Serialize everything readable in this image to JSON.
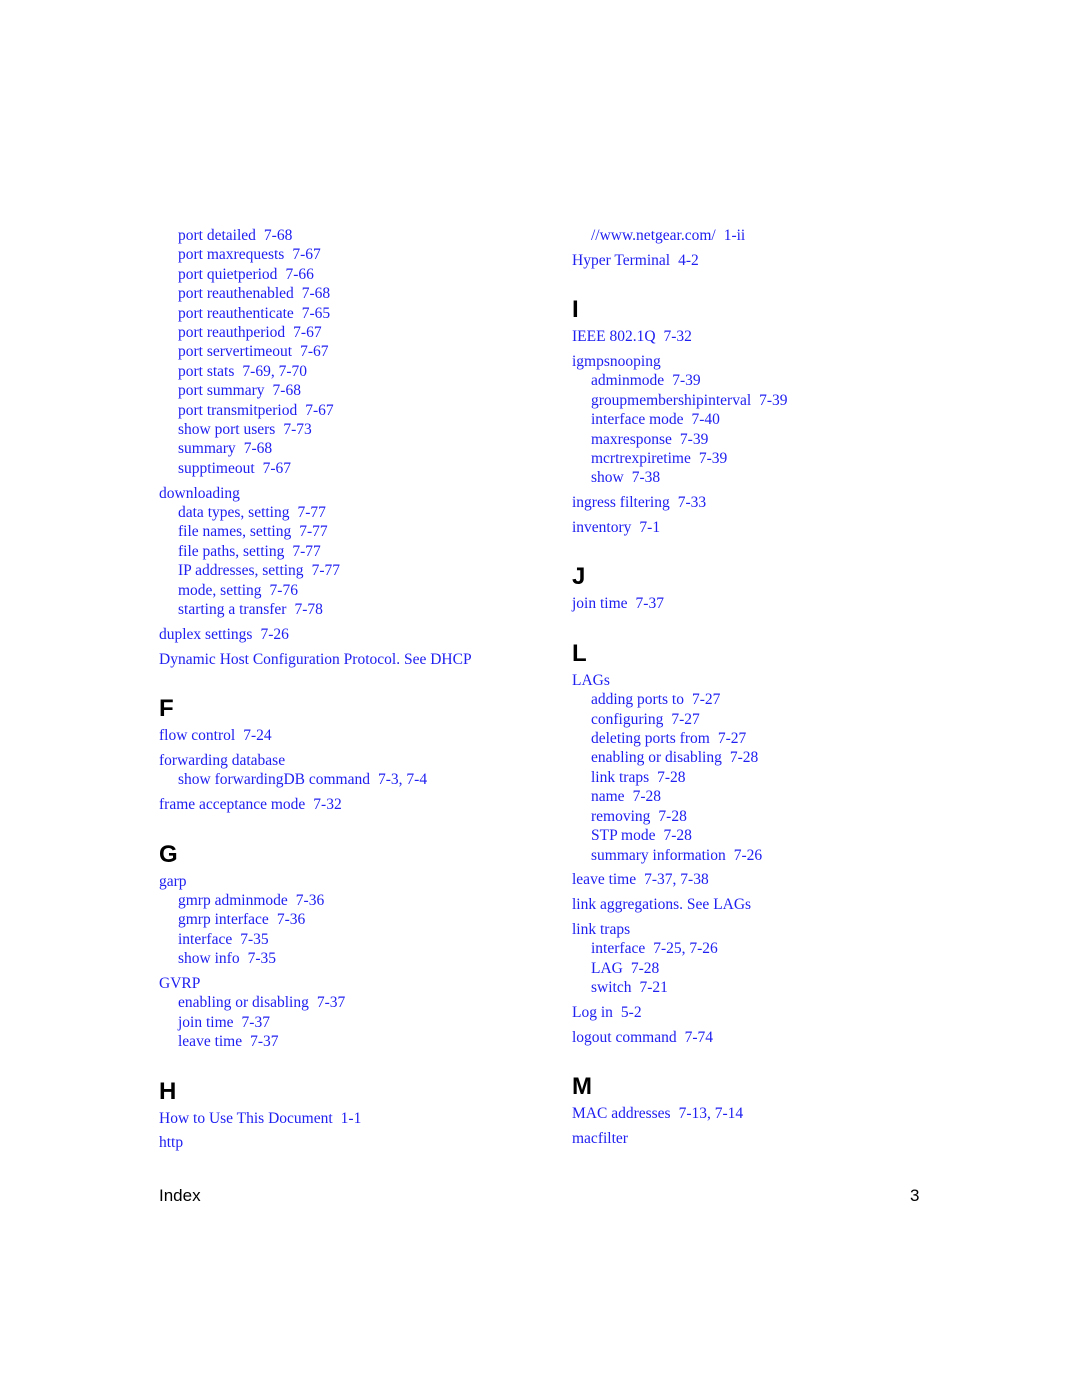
{
  "left_column": [
    {
      "type": "sub",
      "term": "port detailed",
      "pages": "7-68"
    },
    {
      "type": "sub",
      "term": "port maxrequests",
      "pages": "7-67"
    },
    {
      "type": "sub",
      "term": "port quietperiod",
      "pages": "7-66"
    },
    {
      "type": "sub",
      "term": "port reauthenabled",
      "pages": "7-68"
    },
    {
      "type": "sub",
      "term": "port reauthenticate",
      "pages": "7-65"
    },
    {
      "type": "sub",
      "term": "port reauthperiod",
      "pages": "7-67"
    },
    {
      "type": "sub",
      "term": "port servertimeout",
      "pages": "7-67"
    },
    {
      "type": "sub",
      "term": "port stats",
      "pages": "7-69, 7-70"
    },
    {
      "type": "sub",
      "term": "port summary",
      "pages": "7-68"
    },
    {
      "type": "sub",
      "term": "port transmitperiod",
      "pages": "7-67"
    },
    {
      "type": "sub",
      "term": "show port users",
      "pages": "7-73"
    },
    {
      "type": "sub",
      "term": "summary",
      "pages": "7-68"
    },
    {
      "type": "sub",
      "term": "supptimeout",
      "pages": "7-67"
    },
    {
      "type": "top",
      "term": "downloading",
      "pages": ""
    },
    {
      "type": "sub",
      "term": "data types, setting",
      "pages": "7-77"
    },
    {
      "type": "sub",
      "term": "file names, setting",
      "pages": "7-77"
    },
    {
      "type": "sub",
      "term": "file paths, setting",
      "pages": "7-77"
    },
    {
      "type": "sub",
      "term": "IP addresses, setting",
      "pages": "7-77"
    },
    {
      "type": "sub",
      "term": "mode, setting",
      "pages": "7-76"
    },
    {
      "type": "sub",
      "term": "starting a transfer",
      "pages": "7-78"
    },
    {
      "type": "top",
      "term": "duplex settings",
      "pages": "7-26"
    },
    {
      "type": "top",
      "term": "Dynamic Host Configuration Protocol. See DHCP",
      "pages": ""
    },
    {
      "type": "letter",
      "term": "F"
    },
    {
      "type": "top",
      "term": "flow control",
      "pages": "7-24"
    },
    {
      "type": "top",
      "term": "forwarding database",
      "pages": ""
    },
    {
      "type": "sub",
      "term": "show forwardingDB command",
      "pages": "7-3, 7-4"
    },
    {
      "type": "top",
      "term": "frame acceptance mode",
      "pages": "7-32"
    },
    {
      "type": "letter",
      "term": "G"
    },
    {
      "type": "top",
      "term": "garp",
      "pages": ""
    },
    {
      "type": "sub",
      "term": "gmrp adminmode",
      "pages": "7-36"
    },
    {
      "type": "sub",
      "term": "gmrp interface",
      "pages": "7-36"
    },
    {
      "type": "sub",
      "term": "interface",
      "pages": "7-35"
    },
    {
      "type": "sub",
      "term": "show info",
      "pages": "7-35"
    },
    {
      "type": "top",
      "term": "GVRP",
      "pages": ""
    },
    {
      "type": "sub",
      "term": "enabling or disabling",
      "pages": "7-37"
    },
    {
      "type": "sub",
      "term": "join time",
      "pages": "7-37"
    },
    {
      "type": "sub",
      "term": "leave time",
      "pages": "7-37"
    },
    {
      "type": "letter",
      "term": "H"
    },
    {
      "type": "top",
      "term": "How to Use This Document",
      "pages": "1-1"
    },
    {
      "type": "top",
      "term": "http",
      "pages": ""
    }
  ],
  "right_column": [
    {
      "type": "sub",
      "term": "//www.netgear.com/",
      "pages": "1-ii"
    },
    {
      "type": "top",
      "term": "Hyper Terminal",
      "pages": "4-2"
    },
    {
      "type": "letter",
      "term": "I"
    },
    {
      "type": "top",
      "term": "IEEE 802.1Q",
      "pages": "7-32"
    },
    {
      "type": "top",
      "term": "igmpsnooping",
      "pages": ""
    },
    {
      "type": "sub",
      "term": "adminmode",
      "pages": "7-39"
    },
    {
      "type": "sub",
      "term": "groupmembershipinterval",
      "pages": "7-39"
    },
    {
      "type": "sub",
      "term": "interface mode",
      "pages": "7-40"
    },
    {
      "type": "sub",
      "term": "maxresponse",
      "pages": "7-39"
    },
    {
      "type": "sub",
      "term": "mcrtrexpiretime",
      "pages": "7-39"
    },
    {
      "type": "sub",
      "term": "show",
      "pages": "7-38"
    },
    {
      "type": "top",
      "term": "ingress filtering",
      "pages": "7-33"
    },
    {
      "type": "top",
      "term": "inventory",
      "pages": "7-1"
    },
    {
      "type": "letter",
      "term": "J"
    },
    {
      "type": "top",
      "term": "join time",
      "pages": "7-37"
    },
    {
      "type": "letter",
      "term": "L"
    },
    {
      "type": "top",
      "term": "LAGs",
      "pages": ""
    },
    {
      "type": "sub",
      "term": "adding ports to",
      "pages": "7-27"
    },
    {
      "type": "sub",
      "term": "configuring",
      "pages": "7-27"
    },
    {
      "type": "sub",
      "term": "deleting ports from",
      "pages": "7-27"
    },
    {
      "type": "sub",
      "term": "enabling or disabling",
      "pages": "7-28"
    },
    {
      "type": "sub",
      "term": "link traps",
      "pages": "7-28"
    },
    {
      "type": "sub",
      "term": "name",
      "pages": "7-28"
    },
    {
      "type": "sub",
      "term": "removing",
      "pages": "7-28"
    },
    {
      "type": "sub",
      "term": "STP mode",
      "pages": "7-28"
    },
    {
      "type": "sub",
      "term": "summary information",
      "pages": "7-26"
    },
    {
      "type": "top",
      "term": "leave time",
      "pages": "7-37, 7-38"
    },
    {
      "type": "top",
      "term": "link aggregations. See LAGs",
      "pages": ""
    },
    {
      "type": "top",
      "term": "link traps",
      "pages": ""
    },
    {
      "type": "sub",
      "term": "interface",
      "pages": "7-25, 7-26"
    },
    {
      "type": "sub",
      "term": "LAG",
      "pages": "7-28"
    },
    {
      "type": "sub",
      "term": "switch",
      "pages": "7-21"
    },
    {
      "type": "top",
      "term": "Log in",
      "pages": "5-2"
    },
    {
      "type": "top",
      "term": "logout command",
      "pages": "7-74"
    },
    {
      "type": "letter",
      "term": "M"
    },
    {
      "type": "top",
      "term": "MAC addresses",
      "pages": "7-13, 7-14"
    },
    {
      "type": "top",
      "term": "macfilter",
      "pages": ""
    }
  ],
  "footer": {
    "section": "Index",
    "page_number": "3"
  },
  "colors": {
    "link": "#2020f0",
    "heading": "#000000"
  }
}
